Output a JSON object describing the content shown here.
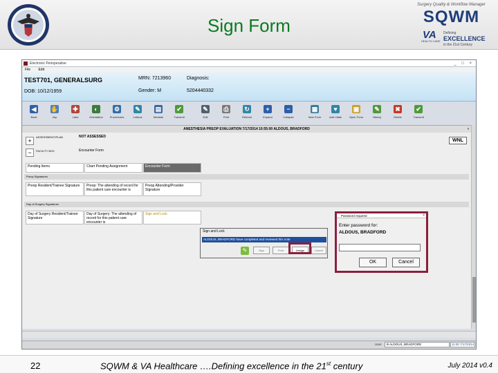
{
  "slide": {
    "title": "Sign Form",
    "page_number": "22",
    "footer_text_before": "SQWM & VA Healthcare ….Defining excellence in the 21",
    "footer_text_sup": "st",
    "footer_text_after": " century",
    "footer_date": "July 2014 v0.4"
  },
  "logo": {
    "tagline": "Surgery Quality & Workflow Manager",
    "name": "SQWM",
    "va": "VA",
    "va_sub": "HEALTH CARE",
    "defining": "Defining",
    "excellence": "EXCELLENCE",
    "century": "in the 21st Century"
  },
  "app": {
    "window_title": "Electronic Perioperative",
    "menu": [
      "File",
      "Edit"
    ],
    "window_controls": "_ □ ×",
    "patient": {
      "name": "TEST701, GENERALSURG",
      "dob": "DOB: 10/12/1959",
      "mrn": "MRN: 7213960",
      "gender": "Gender: M",
      "diagnosis_label": "Diagnosis:",
      "diagnosis_code": "5204440332"
    },
    "toolbar": [
      {
        "label": "Back",
        "color": "#2d5fa8",
        "glyph": "◀"
      },
      {
        "label": "Imp",
        "color": "#4a7fc1",
        "glyph": "✋"
      },
      {
        "label": "Labs",
        "color": "#b0453a",
        "glyph": "✚"
      },
      {
        "label": "Orientation",
        "color": "#3b7b3b",
        "glyph": "◐"
      },
      {
        "label": "Procedures",
        "color": "#2f6ea8",
        "glyph": "⚙"
      },
      {
        "label": "Lettous",
        "color": "#2f86a8",
        "glyph": "✎"
      },
      {
        "label": "Mediate",
        "color": "#3b66a0",
        "glyph": "▤"
      },
      {
        "label": "Transmit",
        "color": "#4f9a3a",
        "glyph": "✔"
      },
      {
        "label": "Edit",
        "color": "#506070",
        "glyph": "✎"
      },
      {
        "label": "Print",
        "color": "#7a7a7a",
        "glyph": "⎙"
      },
      {
        "label": "Refresh",
        "color": "#2f86a8",
        "glyph": "↻"
      },
      {
        "label": "Expand",
        "color": "#2d5fa8",
        "glyph": "+"
      },
      {
        "label": "Collapse",
        "color": "#2d5fa8",
        "glyph": "−"
      },
      {
        "label": "New Form",
        "color": "#3b7b9b",
        "glyph": "▦"
      },
      {
        "label": "Add Vitals",
        "color": "#2f86a8",
        "glyph": "♥"
      },
      {
        "label": "Open Form",
        "color": "#caa12f",
        "glyph": "▣"
      },
      {
        "label": "History",
        "color": "#4f9a3a",
        "glyph": "✎"
      },
      {
        "label": "Delete",
        "color": "#c43a2a",
        "glyph": "✖"
      },
      {
        "label": "Transmit",
        "color": "#4f9a3a",
        "glyph": "✔"
      }
    ],
    "form_header": "ANESTHESIA PREOP EVALUATION 7/17/2014 10:55:00 ALDOUS, BRADFORD",
    "assessment_label": "ASSESSMENT/PLAN",
    "assessment_value": "NOT ASSESSED",
    "facility_label": "FACILITY BOX",
    "facility_value": "Encounter Form",
    "wnl_label": "WNL",
    "pending": {
      "items": "Pending Items",
      "chart": "Chart Pending Assignment",
      "encounter": "Encounter Form"
    },
    "preop_signatures_label": "Preop Signatures",
    "preop_cells": [
      "Preop Resident/Trainee Signature",
      "Preop: The attending of record for this patient care encounter is",
      "Preop Attending/Provider Signature"
    ],
    "dos_signatures_label": "Day of Surgery Signatures",
    "dos_cells": [
      "Day of Surgery Resident/Trainee Signature",
      "Day of Surgery: The attending of record for this patient care encounter is",
      "Sign and Lock"
    ],
    "sign_lock": {
      "title": "Sign and Lock",
      "message": "ALDOUS, BRADFORD have completed and reviewed this note",
      "buttons": [
        "Sign",
        "Print",
        "Unsign",
        "Cancel"
      ]
    },
    "password_dialog": {
      "title": "Password required",
      "close": "×",
      "prompt": "Enter password for:",
      "user": "ALDOUS, BRADFORD",
      "ok": "OK",
      "cancel": "Cancel"
    },
    "status": {
      "user_label": "User",
      "user_value": "B ALDOUS, BRADFORD",
      "time": "11:00 7/17/2014"
    }
  }
}
